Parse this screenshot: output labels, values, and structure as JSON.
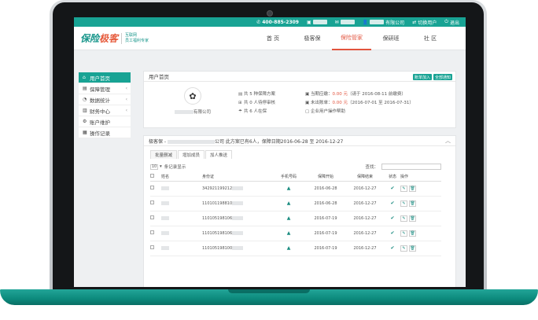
{
  "topbar": {
    "phone": "400-885-2309",
    "items": [
      "",
      "",
      "",
      "有限公司",
      "切换用户",
      "退出"
    ]
  },
  "logo": {
    "main": "保险",
    "accent": "极客",
    "sub1": "互联网",
    "sub2": "员工福利专家"
  },
  "nav": [
    "首 页",
    "极客保",
    "保险管家",
    "保研班",
    "社 区"
  ],
  "nav_active": "保险管家",
  "sidebar": [
    {
      "label": "用户首页",
      "icon": "home-icon",
      "active": true
    },
    {
      "label": "保障管理",
      "icon": "shield-icon",
      "chevron": true
    },
    {
      "label": "数据统计",
      "icon": "chart-icon",
      "chevron": true
    },
    {
      "label": "财务中心",
      "icon": "wallet-icon",
      "chevron": true
    },
    {
      "label": "账户维护",
      "icon": "gear-icon"
    },
    {
      "label": "操作记录",
      "icon": "list-icon"
    }
  ],
  "panel1": {
    "title": "用户首页",
    "btn1": "账单加入",
    "btn2": "全部通知",
    "company": "有限公司",
    "stats": [
      "共 5 种保障方案",
      "共 0 人待停审核",
      "共 6 人在保"
    ],
    "bill_current": "当期应缴：",
    "bill_current_amt": "0.00 元",
    "bill_current_note": "（请于 2016-08-11 前缴费）",
    "bill_unpaid": "未出账单：",
    "bill_unpaid_amt": "0.00 元",
    "bill_unpaid_note": "（2016-07-01 至 2016-07-31）",
    "help": "企业用户操作帮助"
  },
  "panel2": {
    "title_prefix": "极客保 -",
    "title_rest": "公司 此方案已有6人，保障日期2016-06-28 至 2016-12-27",
    "tabs": [
      "批量删减",
      "增加成员",
      "加人推送"
    ],
    "page_size": "10",
    "page_size_label": "条记录显示",
    "search_label": "查找：",
    "columns": [
      "姓名",
      "身份证",
      "手机号码",
      "保障开始",
      "保障结束",
      "状态",
      "操作"
    ],
    "rows": [
      {
        "id": "342921199212",
        "start": "2016-06-28",
        "end": "2016-12-27"
      },
      {
        "id": "110101198810",
        "start": "2016-06-28",
        "end": "2016-12-27"
      },
      {
        "id": "110105198106",
        "start": "2016-07-19",
        "end": "2016-12-27"
      },
      {
        "id": "110105198106",
        "start": "2016-07-19",
        "end": "2016-12-27"
      },
      {
        "id": "110105198100",
        "start": "2016-07-19",
        "end": "2016-12-27"
      }
    ]
  }
}
